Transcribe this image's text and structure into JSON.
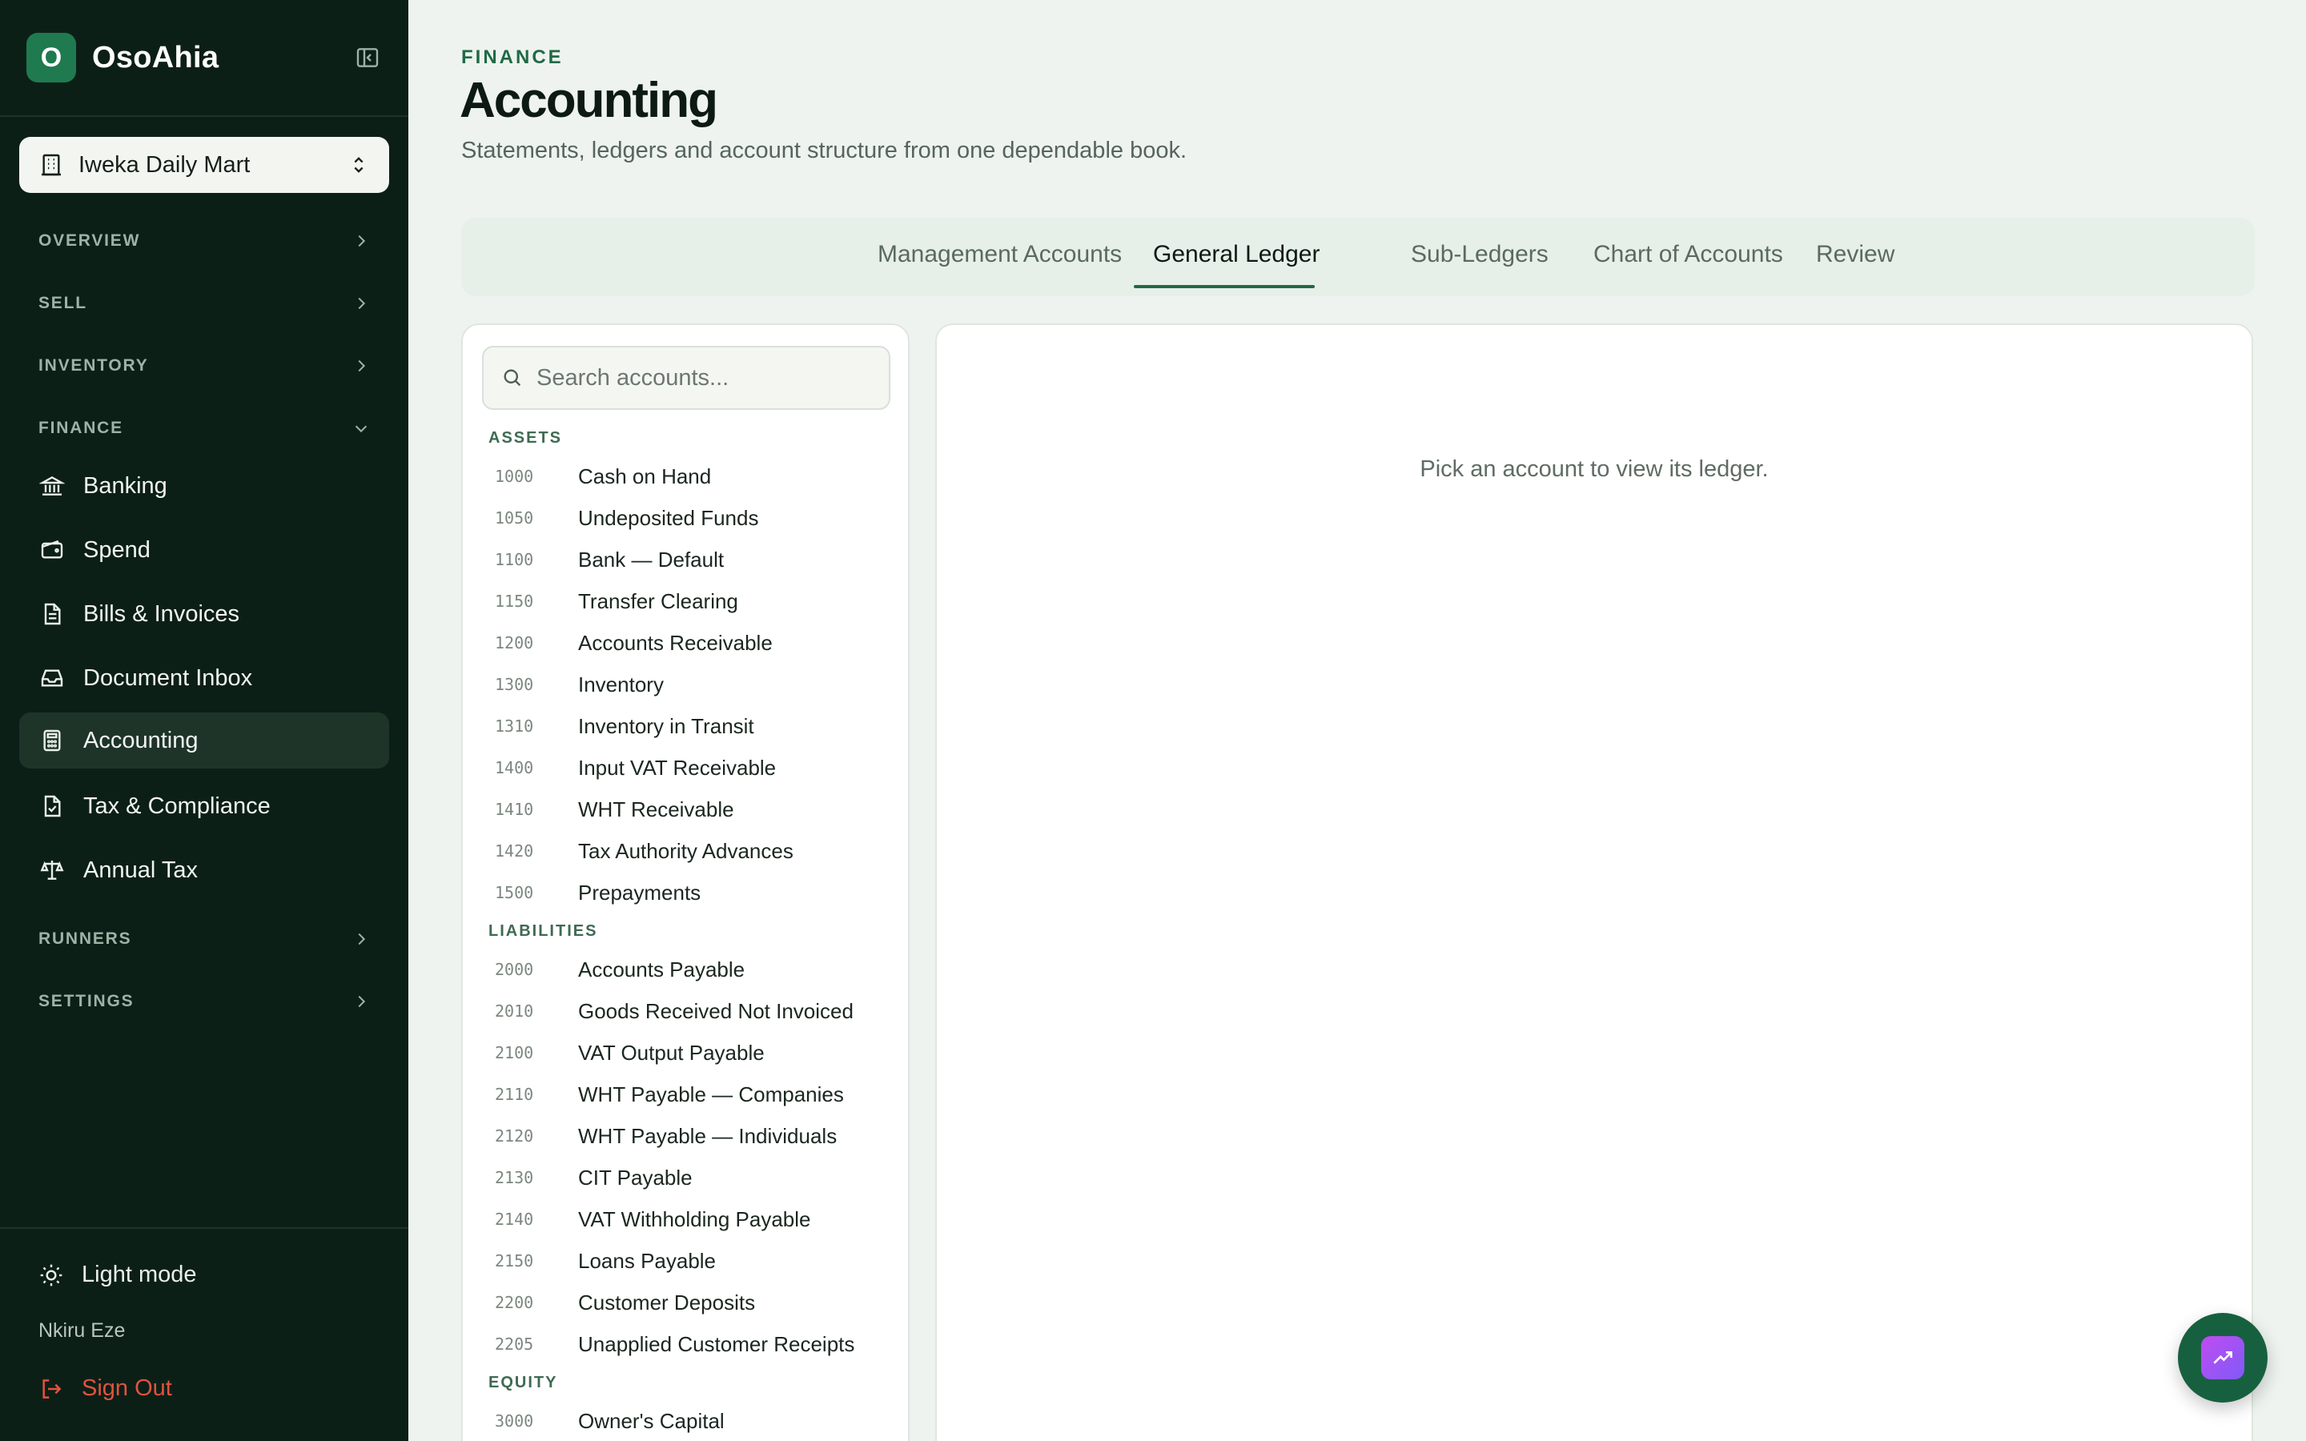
{
  "app": {
    "logo_letter": "O",
    "name": "OsoAhia"
  },
  "store": {
    "name": "Iweka Daily Mart"
  },
  "sidebar": {
    "sections": {
      "overview": "OVERVIEW",
      "sell": "SELL",
      "inventory": "INVENTORY",
      "finance": "FINANCE",
      "runners": "RUNNERS",
      "settings": "SETTINGS"
    },
    "finance_items": [
      {
        "label": "Banking",
        "icon": "bank-icon"
      },
      {
        "label": "Spend",
        "icon": "wallet-icon"
      },
      {
        "label": "Bills & Invoices",
        "icon": "document-icon"
      },
      {
        "label": "Document Inbox",
        "icon": "inbox-icon"
      },
      {
        "label": "Accounting",
        "icon": "calculator-icon",
        "active": true
      },
      {
        "label": "Tax & Compliance",
        "icon": "file-check-icon"
      },
      {
        "label": "Annual Tax",
        "icon": "scale-icon"
      }
    ],
    "theme_toggle": "Light mode",
    "user_name": "Nkiru Eze",
    "sign_out": "Sign Out"
  },
  "header": {
    "eyebrow": "FINANCE",
    "title": "Accounting",
    "subtitle": "Statements, ledgers and account structure from one dependable book."
  },
  "tabs": [
    {
      "label": "Management Accounts"
    },
    {
      "label": "General Ledger",
      "active": true
    },
    {
      "label": "Sub-Ledgers"
    },
    {
      "label": "Chart of Accounts"
    },
    {
      "label": "Review"
    }
  ],
  "accounts": {
    "search_placeholder": "Search accounts...",
    "groups": [
      {
        "title": "ASSETS",
        "items": [
          {
            "code": "1000",
            "name": "Cash on Hand"
          },
          {
            "code": "1050",
            "name": "Undeposited Funds"
          },
          {
            "code": "1100",
            "name": "Bank — Default"
          },
          {
            "code": "1150",
            "name": "Transfer Clearing"
          },
          {
            "code": "1200",
            "name": "Accounts Receivable"
          },
          {
            "code": "1300",
            "name": "Inventory"
          },
          {
            "code": "1310",
            "name": "Inventory in Transit"
          },
          {
            "code": "1400",
            "name": "Input VAT Receivable"
          },
          {
            "code": "1410",
            "name": "WHT Receivable"
          },
          {
            "code": "1420",
            "name": "Tax Authority Advances"
          },
          {
            "code": "1500",
            "name": "Prepayments"
          }
        ]
      },
      {
        "title": "LIABILITIES",
        "items": [
          {
            "code": "2000",
            "name": "Accounts Payable"
          },
          {
            "code": "2010",
            "name": "Goods Received Not Invoiced"
          },
          {
            "code": "2100",
            "name": "VAT Output Payable"
          },
          {
            "code": "2110",
            "name": "WHT Payable — Companies"
          },
          {
            "code": "2120",
            "name": "WHT Payable — Individuals"
          },
          {
            "code": "2130",
            "name": "CIT Payable"
          },
          {
            "code": "2140",
            "name": "VAT Withholding Payable"
          },
          {
            "code": "2150",
            "name": "Loans Payable"
          },
          {
            "code": "2200",
            "name": "Customer Deposits"
          },
          {
            "code": "2205",
            "name": "Unapplied Customer Receipts"
          }
        ]
      },
      {
        "title": "EQUITY",
        "items": [
          {
            "code": "3000",
            "name": "Owner's Capital"
          }
        ]
      }
    ]
  },
  "ledger": {
    "empty_message": "Pick an account to view its ledger."
  },
  "colors": {
    "sidebar_bg": "#0c1f17",
    "accent": "#1f6a45",
    "danger": "#e0533f",
    "fab_gradient": [
      "#c04cf2",
      "#7f5af7"
    ]
  }
}
